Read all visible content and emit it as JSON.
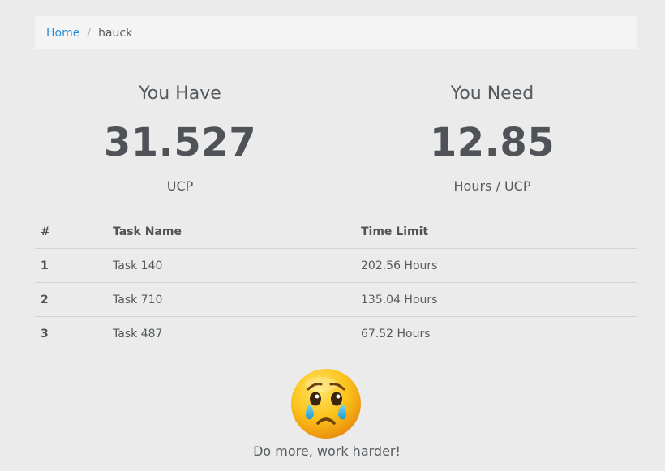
{
  "breadcrumb": {
    "home": "Home",
    "separator": "/",
    "current": "hauck"
  },
  "stats": {
    "have": {
      "label": "You Have",
      "value": "31.527",
      "unit": "UCP"
    },
    "need": {
      "label": "You Need",
      "value": "12.85",
      "unit": "Hours / UCP"
    }
  },
  "table": {
    "headers": [
      "#",
      "Task Name",
      "Time Limit"
    ],
    "rows": [
      {
        "num": "1",
        "name": "Task 140",
        "limit": "202.56 Hours"
      },
      {
        "num": "2",
        "name": "Task 710",
        "limit": "135.04 Hours"
      },
      {
        "num": "3",
        "name": "Task 487",
        "limit": "67.52 Hours"
      }
    ]
  },
  "feedback": {
    "icon": "crying-face-icon",
    "message": "Do more, work harder!"
  },
  "colors": {
    "background": "#ebebeb",
    "link": "#2a8dd4",
    "text": "#555a5e"
  }
}
